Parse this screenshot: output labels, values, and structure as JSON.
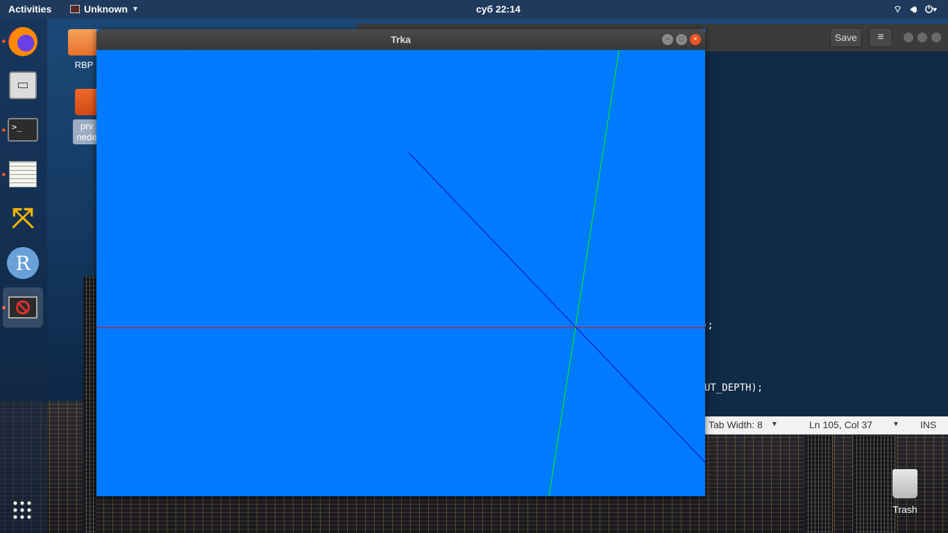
{
  "topbar": {
    "activities": "Activities",
    "app_name": "Unknown",
    "clock": "суб 22:14",
    "tray_icons": [
      "wifi-icon",
      "volume-icon",
      "power-icon"
    ]
  },
  "dock": {
    "items": [
      {
        "name": "firefox",
        "running": true
      },
      {
        "name": "files",
        "running": false
      },
      {
        "name": "terminal",
        "running": true
      },
      {
        "name": "text-editor",
        "running": true
      },
      {
        "name": "vmware",
        "running": false
      },
      {
        "name": "r-studio",
        "running": false
      },
      {
        "name": "unknown-app",
        "running": true,
        "active": true
      }
    ],
    "terminal_glyph": ">_"
  },
  "desktop": {
    "icons": [
      {
        "label": "RBP"
      },
      {
        "label": "prv\nnede"
      }
    ],
    "trash_label": "Trash"
  },
  "gedit": {
    "save_label": "Save",
    "menu_glyph": "≡",
    "code_line_1": ");",
    "code_line_2": "UT_DEPTH);",
    "status": {
      "tab_width": "Tab Width: 8",
      "position": "Ln 105, Col 37",
      "mode": "INS"
    }
  },
  "trka": {
    "title": "Trka",
    "background": "#007bff",
    "axes": {
      "x_color": "#ff0000",
      "y_color": "#00ff00",
      "z_color": "#0000cc"
    }
  }
}
